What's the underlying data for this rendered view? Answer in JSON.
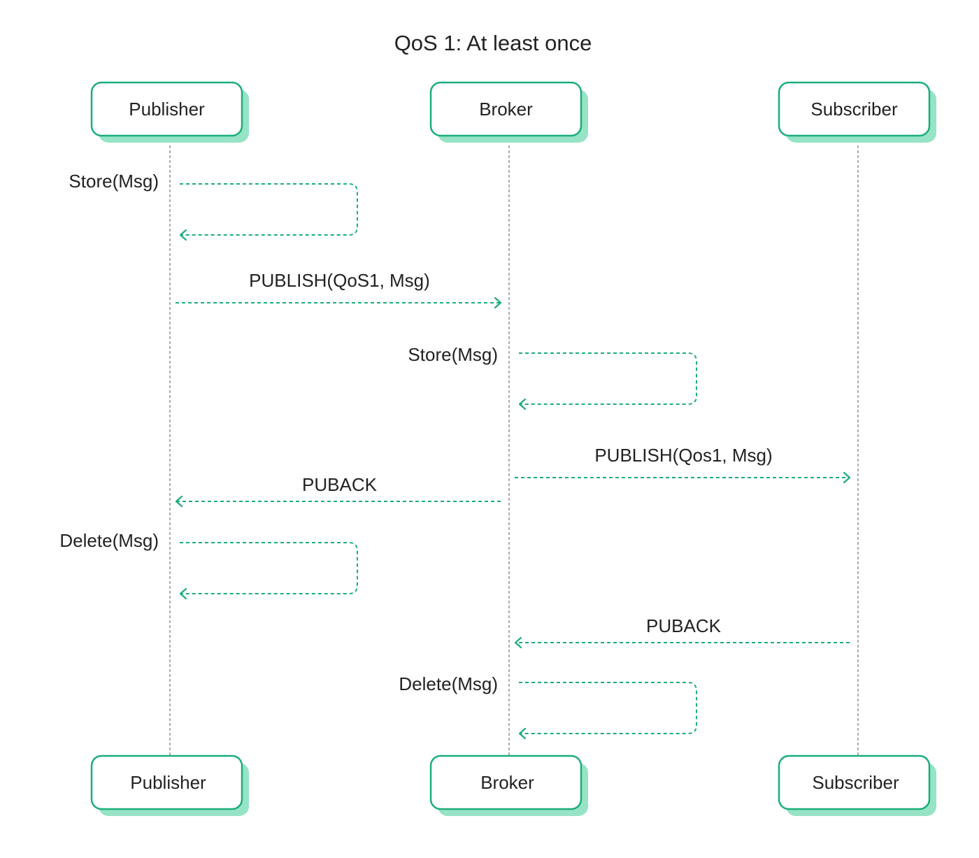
{
  "title": "QoS 1: At least once",
  "colors": {
    "accent": "#1AAE7B",
    "shadow": "#97E3C6",
    "lifeline": "#999999",
    "text": "#222222"
  },
  "actors": [
    {
      "id": "publisher",
      "label": "Publisher"
    },
    {
      "id": "broker",
      "label": "Broker"
    },
    {
      "id": "subscriber",
      "label": "Subscriber"
    }
  ],
  "messages": [
    {
      "type": "self",
      "actor": "publisher",
      "label": "Store(Msg)"
    },
    {
      "type": "call",
      "from": "publisher",
      "to": "broker",
      "label": "PUBLISH(QoS1, Msg)"
    },
    {
      "type": "self",
      "actor": "broker",
      "label": "Store(Msg)"
    },
    {
      "type": "call",
      "from": "broker",
      "to": "subscriber",
      "label": "PUBLISH(Qos1, Msg)"
    },
    {
      "type": "call",
      "from": "broker",
      "to": "publisher",
      "label": "PUBACK"
    },
    {
      "type": "self",
      "actor": "publisher",
      "label": "Delete(Msg)"
    },
    {
      "type": "call",
      "from": "subscriber",
      "to": "broker",
      "label": "PUBACK"
    },
    {
      "type": "self",
      "actor": "broker",
      "label": "Delete(Msg)"
    }
  ]
}
